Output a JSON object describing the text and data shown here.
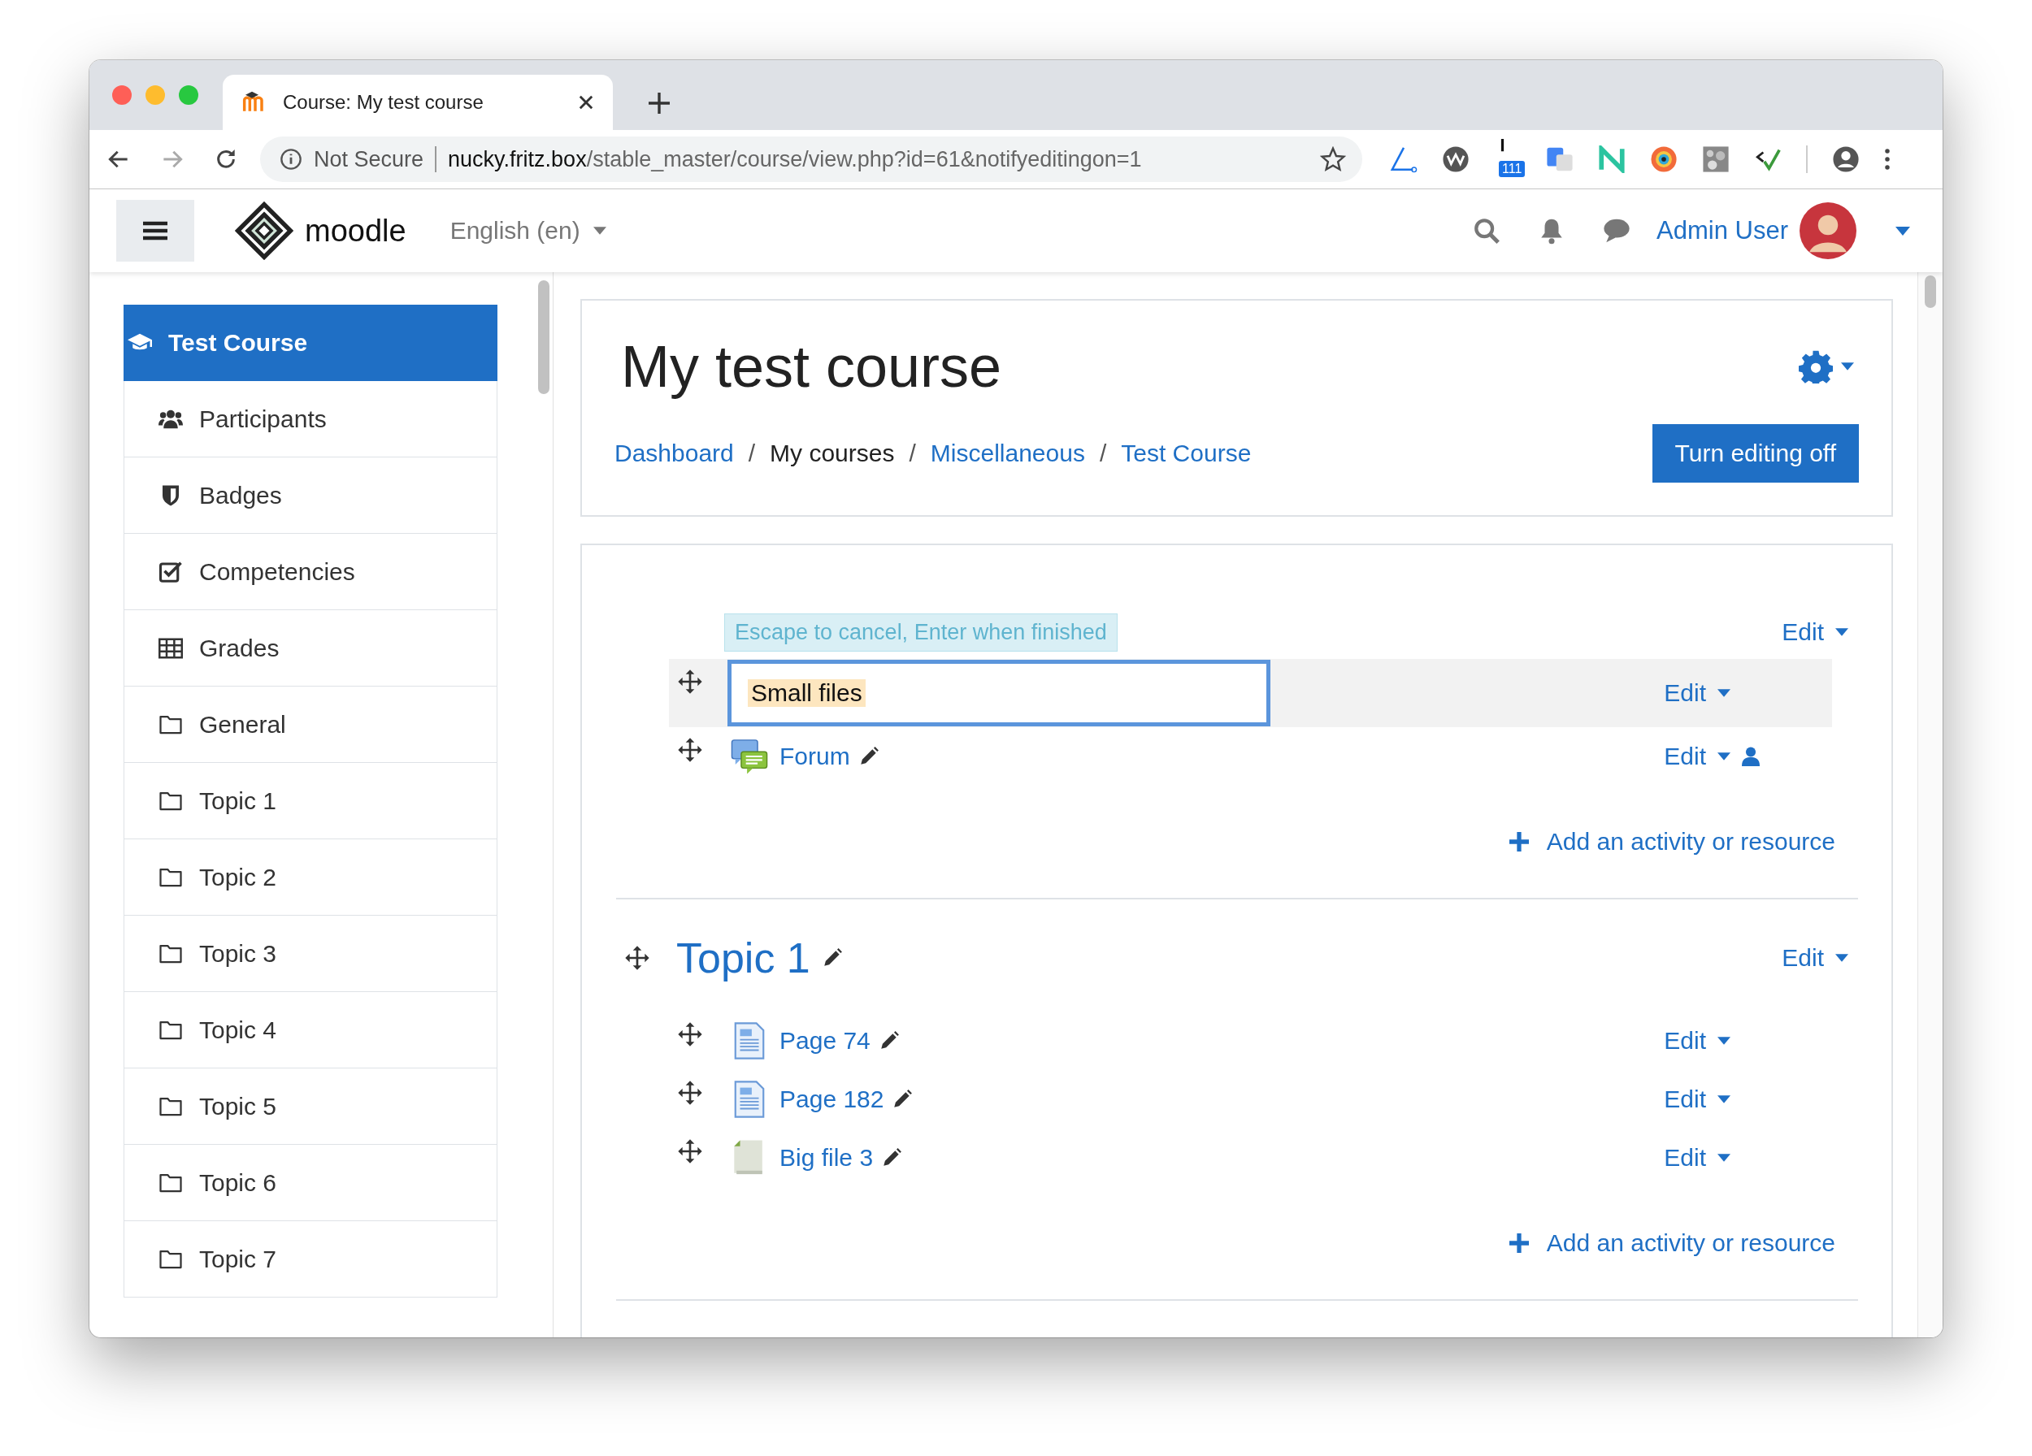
{
  "browser": {
    "tab": {
      "title": "Course: My test course"
    },
    "address": {
      "security": "Not Secure",
      "host": "nucky.fritz.box",
      "path": "/stable_master/course/view.php?id=61&notifyeditingon=1"
    },
    "extension_badge": "111"
  },
  "navbar": {
    "brand": "moodle",
    "language": "English (en)",
    "user": "Admin User"
  },
  "sidebar": {
    "items": [
      {
        "label": "Test Course",
        "kind": "course",
        "selected": true
      },
      {
        "label": "Participants",
        "kind": "participants",
        "selected": false
      },
      {
        "label": "Badges",
        "kind": "badges",
        "selected": false
      },
      {
        "label": "Competencies",
        "kind": "competencies",
        "selected": false
      },
      {
        "label": "Grades",
        "kind": "grades",
        "selected": false
      },
      {
        "label": "General",
        "kind": "section",
        "selected": false
      },
      {
        "label": "Topic 1",
        "kind": "section",
        "selected": false
      },
      {
        "label": "Topic 2",
        "kind": "section",
        "selected": false
      },
      {
        "label": "Topic 3",
        "kind": "section",
        "selected": false
      },
      {
        "label": "Topic 4",
        "kind": "section",
        "selected": false
      },
      {
        "label": "Topic 5",
        "kind": "section",
        "selected": false
      },
      {
        "label": "Topic 6",
        "kind": "section",
        "selected": false
      },
      {
        "label": "Topic 7",
        "kind": "section",
        "selected": false
      }
    ]
  },
  "header": {
    "title": "My test course",
    "breadcrumb": [
      {
        "label": "Dashboard",
        "kind": "link"
      },
      {
        "label": "/",
        "kind": "separator"
      },
      {
        "label": "My courses",
        "kind": "text"
      },
      {
        "label": "/",
        "kind": "separator"
      },
      {
        "label": "Miscellaneous",
        "kind": "link"
      },
      {
        "label": "/",
        "kind": "separator"
      },
      {
        "label": "Test Course",
        "kind": "link"
      }
    ],
    "editing_button": "Turn editing off"
  },
  "sections": [
    {
      "hint": "Escape to cancel, Enter when finished",
      "edit": "Edit",
      "activities": [
        {
          "kind": "editing",
          "value": "Small files",
          "edit": "Edit"
        },
        {
          "kind": "forum",
          "name": "Forum",
          "edit": "Edit",
          "restricted": true
        }
      ],
      "add": "Add an activity or resource"
    },
    {
      "title": "Topic 1",
      "edit": "Edit",
      "activities": [
        {
          "kind": "page",
          "name": "Page 74",
          "edit": "Edit",
          "restricted": false
        },
        {
          "kind": "page",
          "name": "Page 182",
          "edit": "Edit",
          "restricted": false
        },
        {
          "kind": "file",
          "name": "Big file 3",
          "edit": "Edit",
          "restricted": false
        }
      ],
      "add": "Add an activity or resource"
    }
  ]
}
